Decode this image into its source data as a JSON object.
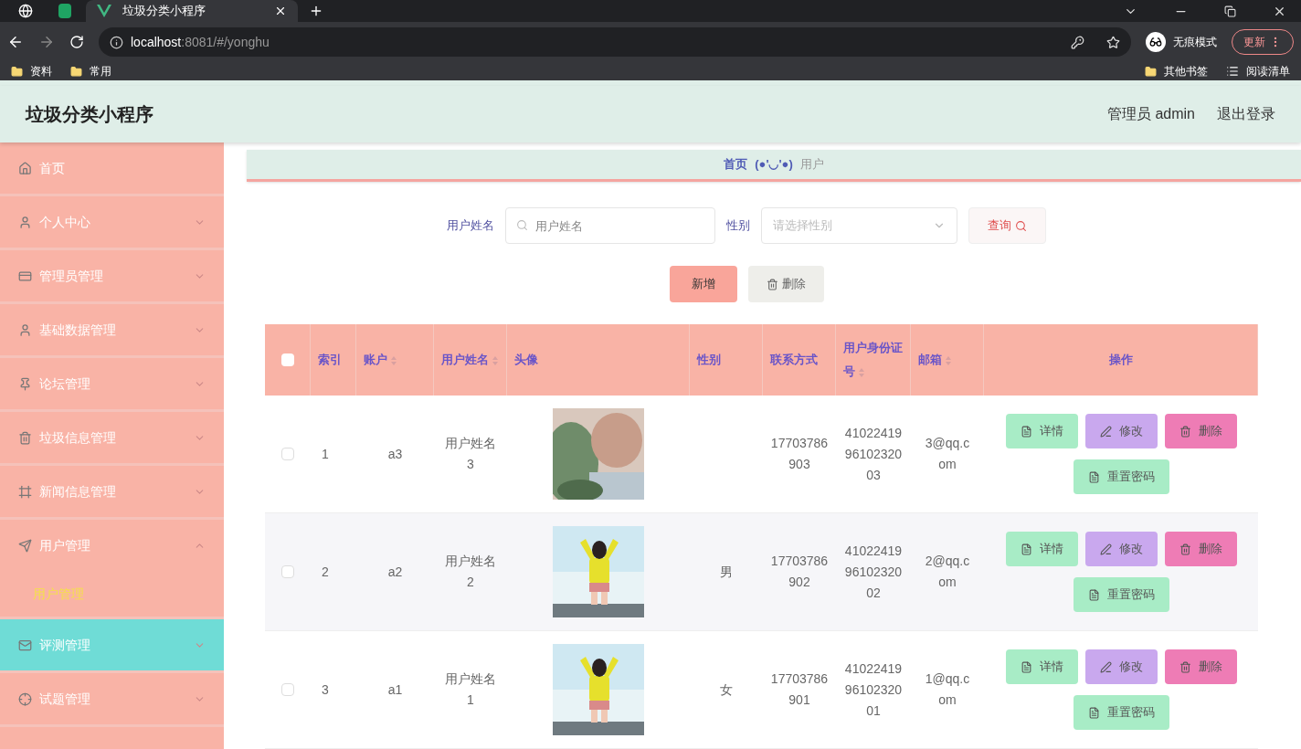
{
  "browser": {
    "tabs": [
      {
        "kind": "globe",
        "selected": false
      },
      {
        "kind": "sheet",
        "selected": false
      },
      {
        "kind": "vue",
        "title": "垃圾分类小程序",
        "selected": true
      }
    ],
    "address": {
      "host": "localhost",
      "rest": ":8081/#/yonghu"
    },
    "profile": "无痕模式",
    "update": "更新",
    "bookmarks": [
      {
        "label": "资料"
      },
      {
        "label": "常用"
      }
    ],
    "bookmarks_right": [
      {
        "kind": "folder",
        "label": "其他书签"
      },
      {
        "kind": "list",
        "label": "阅读清单"
      }
    ]
  },
  "header": {
    "title": "垃圾分类小程序",
    "user": "管理员 admin",
    "logout": "退出登录"
  },
  "sidebar": {
    "items": [
      {
        "kind": "link",
        "label": "首页",
        "hovered": false
      },
      {
        "kind": "menu",
        "label": "个人中心",
        "expanded": false,
        "hovered": false
      },
      {
        "kind": "menu",
        "label": "管理员管理",
        "expanded": false,
        "hovered": false
      },
      {
        "kind": "menu",
        "label": "基础数据管理",
        "expanded": false,
        "hovered": false
      },
      {
        "kind": "menu",
        "label": "论坛管理",
        "expanded": false,
        "hovered": false
      },
      {
        "kind": "menu",
        "label": "垃圾信息管理",
        "expanded": false,
        "hovered": false
      },
      {
        "kind": "menu",
        "label": "新闻信息管理",
        "expanded": false,
        "hovered": false
      },
      {
        "kind": "menu",
        "label": "用户管理",
        "expanded": true,
        "hovered": false,
        "children": [
          {
            "label": "用户管理",
            "selected": true
          }
        ]
      },
      {
        "kind": "menu",
        "label": "评测管理",
        "expanded": false,
        "hovered": true
      },
      {
        "kind": "menu",
        "label": "试题管理",
        "expanded": false,
        "hovered": false
      }
    ]
  },
  "breadcrumb": {
    "home": "首页",
    "face": "(●'◡'●)",
    "current": "用户"
  },
  "search": {
    "name_label": "用户姓名",
    "name_placeholder": "用户姓名",
    "sex_label": "性别",
    "sex_placeholder": "请选择性别",
    "query": "查询"
  },
  "actions": {
    "add": "新增",
    "delete": "删除"
  },
  "table": {
    "select_all_checked": false,
    "columns": [
      {
        "label": "索引",
        "sortable": false
      },
      {
        "label": "账户",
        "sortable": true
      },
      {
        "label": "用户姓名",
        "sortable": true
      },
      {
        "label": "头像",
        "sortable": false
      },
      {
        "label": "性别",
        "sortable": false
      },
      {
        "label": "联系方式",
        "sortable": false
      },
      {
        "label": "用户身份证号",
        "sortable": true
      },
      {
        "label": "邮箱",
        "sortable": true
      },
      {
        "label": "操作",
        "sortable": false
      }
    ],
    "rows": [
      {
        "checked": false,
        "index": "1",
        "account": "a3",
        "name": "用户姓名3",
        "phone": "17703786903",
        "id_card": "410224199610232003",
        "email": "3@qq.com",
        "buttons": [
          {
            "kind": "detail",
            "label": "详情"
          },
          {
            "kind": "edit",
            "label": "修改"
          },
          {
            "kind": "delete",
            "label": "删除"
          },
          {
            "kind": "reset",
            "label": "重置密码"
          }
        ]
      },
      {
        "checked": false,
        "index": "2",
        "account": "a2",
        "name": "用户姓名2",
        "sex": "男",
        "phone": "17703786902",
        "id_card": "410224199610232002",
        "email": "2@qq.com",
        "buttons": [
          {
            "kind": "detail",
            "label": "详情"
          },
          {
            "kind": "edit",
            "label": "修改"
          },
          {
            "kind": "delete",
            "label": "删除"
          },
          {
            "kind": "reset",
            "label": "重置密码"
          }
        ]
      },
      {
        "checked": false,
        "index": "3",
        "account": "a1",
        "name": "用户姓名1",
        "sex": "女",
        "phone": "17703786901",
        "id_card": "410224199610232001",
        "email": "1@qq.com",
        "buttons": [
          {
            "kind": "detail",
            "label": "详情"
          },
          {
            "kind": "edit",
            "label": "修改"
          },
          {
            "kind": "delete",
            "label": "删除"
          },
          {
            "kind": "reset",
            "label": "重置密码"
          }
        ]
      }
    ]
  }
}
